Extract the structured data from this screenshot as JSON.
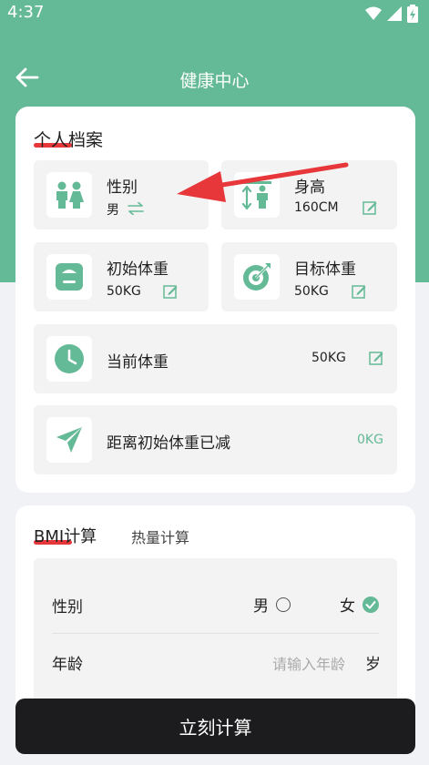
{
  "status": {
    "time": "4:37"
  },
  "header": {
    "title": "健康中心"
  },
  "profile": {
    "title": "个人档案",
    "gender": {
      "label": "性别",
      "value": "男"
    },
    "height": {
      "label": "身高",
      "value": "160CM"
    },
    "initial_weight": {
      "label": "初始体重",
      "value": "50KG"
    },
    "target_weight": {
      "label": "目标体重",
      "value": "50KG"
    },
    "current_weight": {
      "label": "当前体重",
      "value": "50KG"
    },
    "lost": {
      "label": "距离初始体重已减",
      "value": "0KG"
    }
  },
  "calc": {
    "tabs": [
      {
        "label": "BMI计算"
      },
      {
        "label": "热量计算"
      }
    ],
    "gender_label": "性别",
    "male": "男",
    "female": "女",
    "selected_gender": "女",
    "age_label": "年龄",
    "age_placeholder": "请输入年龄",
    "age_unit": "岁"
  },
  "button": {
    "label": "立刻计算"
  },
  "colors": {
    "accent": "#64b996",
    "highlight": "#e8373a",
    "button_bg": "#1c1c1e"
  }
}
